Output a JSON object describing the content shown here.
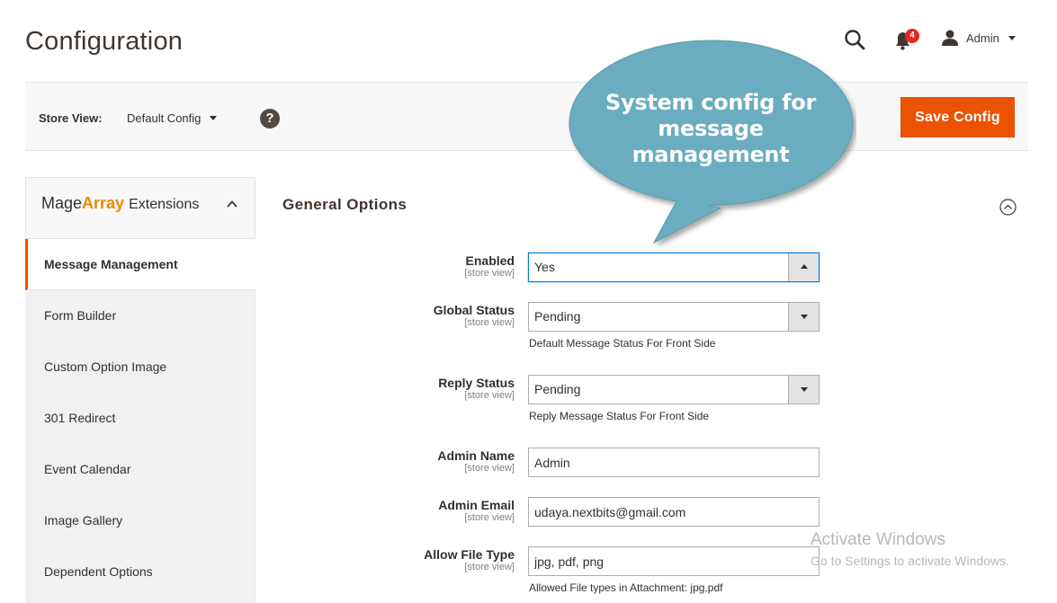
{
  "header": {
    "title": "Configuration",
    "notifications_count": "4",
    "user_name": "Admin"
  },
  "store_bar": {
    "label": "Store View:",
    "selected": "Default Config",
    "help_glyph": "?",
    "save_label": "Save Config"
  },
  "sidebar": {
    "brand_mage": "Mage",
    "brand_array": "Array",
    "brand_ext": "Extensions",
    "items": [
      {
        "label": "Message Management",
        "active": true
      },
      {
        "label": "Form Builder"
      },
      {
        "label": "Custom Option Image"
      },
      {
        "label": "301 Redirect"
      },
      {
        "label": "Event Calendar"
      },
      {
        "label": "Image Gallery"
      },
      {
        "label": "Dependent Options"
      }
    ]
  },
  "section": {
    "title": "General Options",
    "fields": {
      "enabled": {
        "label": "Enabled",
        "scope": "[store view]",
        "value": "Yes"
      },
      "global_status": {
        "label": "Global Status",
        "scope": "[store view]",
        "value": "Pending",
        "note": "Default Message Status For Front Side"
      },
      "reply_status": {
        "label": "Reply Status",
        "scope": "[store view]",
        "value": "Pending",
        "note": "Reply Message Status For Front Side"
      },
      "admin_name": {
        "label": "Admin Name",
        "scope": "[store view]",
        "value": "Admin"
      },
      "admin_email": {
        "label": "Admin Email",
        "scope": "[store view]",
        "value": "udaya.nextbits@gmail.com"
      },
      "allow_file_type": {
        "label": "Allow File Type",
        "scope": "[store view]",
        "value": "jpg, pdf, png",
        "note": "Allowed File types in Attachment: jpg,pdf"
      }
    }
  },
  "callout": {
    "line1": "System config for",
    "line2": "message management"
  },
  "watermark": {
    "line1": "Activate Windows",
    "line2": "Go to Settings to activate Windows."
  },
  "colors": {
    "accent": "#eb5202",
    "brand_array": "#eb8a00",
    "callout_fill": "#6aacc0",
    "badge": "#e22626"
  }
}
